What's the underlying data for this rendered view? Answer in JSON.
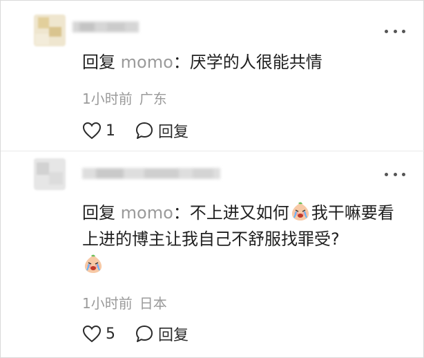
{
  "comments": [
    {
      "reply_prefix": "回复",
      "mention": "momo",
      "separator": "：",
      "body": "厌学的人很能共情",
      "time": "1小时前",
      "location": "广东",
      "likes": "1",
      "reply_label": "回复"
    },
    {
      "reply_prefix": "回复",
      "mention": "momo",
      "separator": "：",
      "body_part1": "不上进又如何",
      "body_part2": "我干嘛要看上进的博主让我自己不舒服找罪受?",
      "time": "1小时前",
      "location": "日本",
      "likes": "5",
      "reply_label": "回复"
    }
  ],
  "icons": {
    "more": "more-options-icon",
    "like": "heart-icon",
    "reply": "comment-bubble-icon",
    "emoji": "crying-face-emoji"
  }
}
